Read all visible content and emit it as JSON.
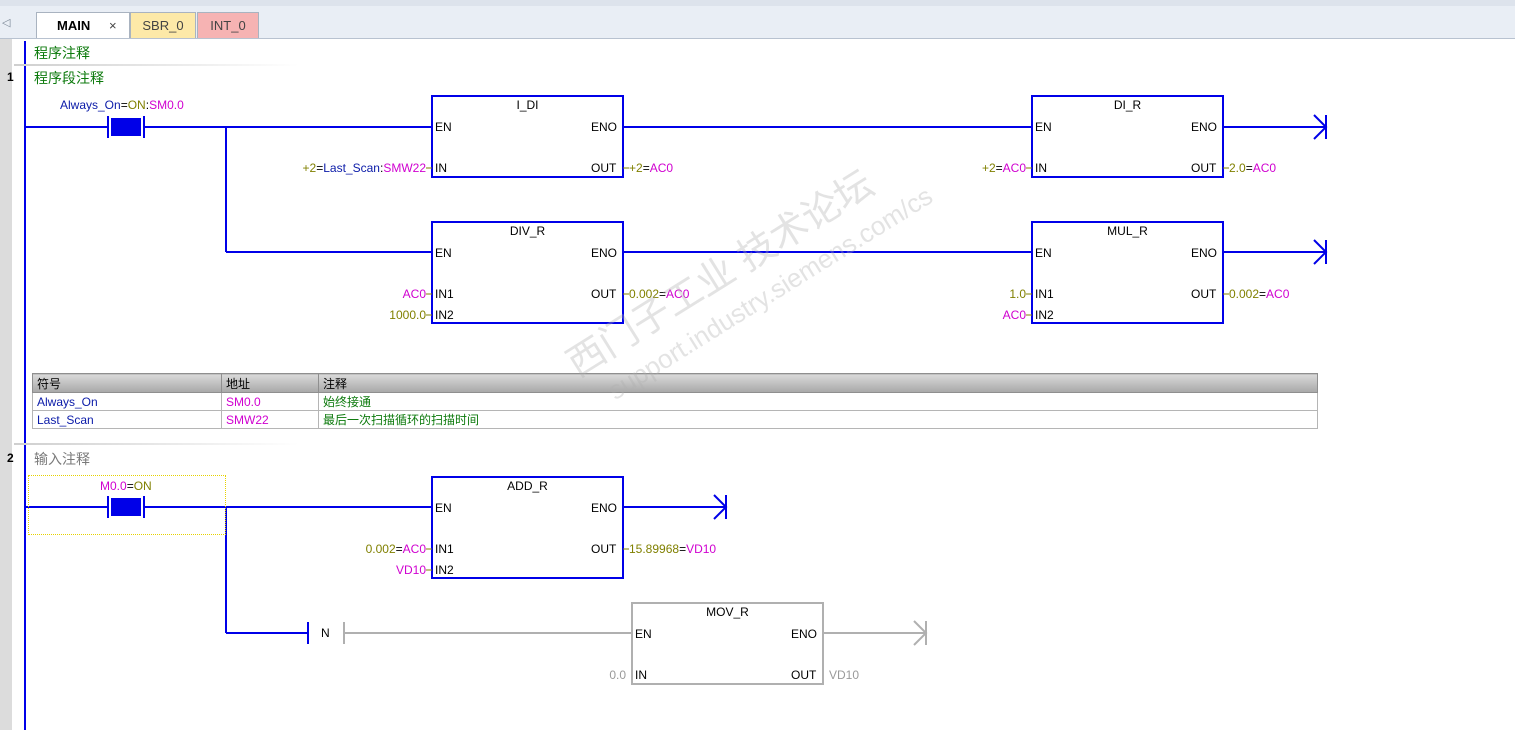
{
  "tabs": [
    {
      "label": "MAIN",
      "close": "×"
    },
    {
      "label": "SBR_0"
    },
    {
      "label": "INT_0"
    }
  ],
  "program_comment": "程序注释",
  "networks": [
    {
      "number": "1",
      "comment": "程序段注释",
      "contact": {
        "symbol": "Always_On",
        "eq": "=",
        "state": "ON",
        "sep": ":",
        "address": "SM0.0"
      },
      "boxes": [
        {
          "title": "I_DI",
          "pins": {
            "en": "EN",
            "eno": "ENO",
            "in": "IN",
            "out": "OUT"
          },
          "in_param": {
            "value": "+2",
            "eq": "=",
            "symbol": "Last_Scan",
            "sep": ":",
            "address": "SMW22"
          },
          "out_param": {
            "value": "+2",
            "eq": "=",
            "address": "AC0"
          }
        },
        {
          "title": "DI_R",
          "pins": {
            "en": "EN",
            "eno": "ENO",
            "in": "IN",
            "out": "OUT"
          },
          "in_param": {
            "value": "+2",
            "eq": "=",
            "address": "AC0"
          },
          "out_param": {
            "value": "2.0",
            "eq": "=",
            "address": "AC0"
          }
        },
        {
          "title": "DIV_R",
          "pins": {
            "en": "EN",
            "eno": "ENO",
            "in1": "IN1",
            "in2": "IN2",
            "out": "OUT"
          },
          "in1_param": {
            "address": "AC0"
          },
          "in2_param": {
            "value": "1000.0"
          },
          "out_param": {
            "value": "0.002",
            "eq": "=",
            "address": "AC0"
          }
        },
        {
          "title": "MUL_R",
          "pins": {
            "en": "EN",
            "eno": "ENO",
            "in1": "IN1",
            "in2": "IN2",
            "out": "OUT"
          },
          "in1_param": {
            "value": "1.0"
          },
          "in2_param": {
            "address": "AC0"
          },
          "out_param": {
            "value": "0.002",
            "eq": "=",
            "address": "AC0"
          }
        }
      ],
      "symbol_table": {
        "headers": [
          "符号",
          "地址",
          "注释"
        ],
        "rows": [
          [
            "Always_On",
            "SM0.0",
            "始终接通"
          ],
          [
            "Last_Scan",
            "SMW22",
            "最后一次扫描循环的扫描时间"
          ]
        ]
      }
    },
    {
      "number": "2",
      "comment": "输入注释",
      "contact": {
        "address": "M0.0",
        "eq": "=",
        "state": "ON"
      },
      "n_contact": "N",
      "boxes": [
        {
          "title": "ADD_R",
          "pins": {
            "en": "EN",
            "eno": "ENO",
            "in1": "IN1",
            "in2": "IN2",
            "out": "OUT"
          },
          "in1_param": {
            "value": "0.002",
            "eq": "=",
            "address": "AC0"
          },
          "in2_param": {
            "address": "VD10"
          },
          "out_param": {
            "value": "15.89968",
            "eq": "=",
            "address": "VD10"
          }
        },
        {
          "title": "MOV_R",
          "pins": {
            "en": "EN",
            "eno": "ENO",
            "in": "IN",
            "out": "OUT"
          },
          "in_param": {
            "value": "0.0"
          },
          "out_param": {
            "address": "VD10"
          }
        }
      ]
    }
  ],
  "watermark": {
    "line1": "西门子工业  技术论坛",
    "line2": "support.industry.siemens.com/cs"
  },
  "colors": {
    "wire": "#0000e8",
    "inactive": "#b0b0b0",
    "symbol": "#0a1aa8",
    "value": "#808000",
    "address": "#d000d0",
    "comment": "#0c7a0c"
  }
}
